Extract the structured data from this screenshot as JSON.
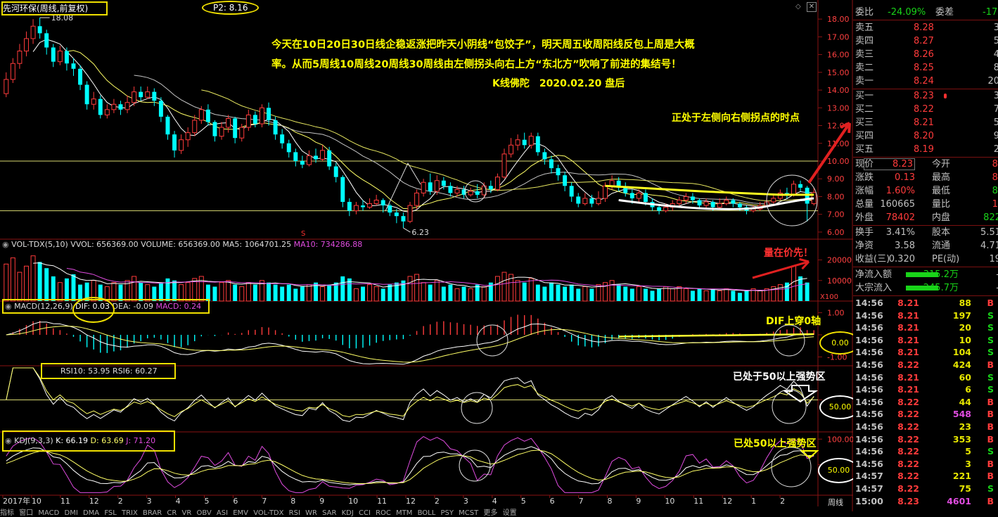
{
  "colors": {
    "up": "#ff3b3b",
    "down": "#00ffff",
    "ma5": "#ffffff",
    "ma10": "#ffff66",
    "ma20": "#c4c4c4",
    "ma30": "#ffff00",
    "annot": "#ffff00",
    "arrow": "#e02020",
    "magenta": "#e04ce0",
    "green": "#19d419"
  },
  "header": {
    "title": "先河环保(周线,前复权)",
    "p2": "P2: 8.16"
  },
  "annotations": {
    "line1": "今天在10日20日30日线企稳返涨把昨天小阴线“包饺子”，明天周五收周阳线反包上周是大概",
    "line2": "率。从而5周线10周线20周线30周线由左侧拐头向右上方“东北方”吹响了前进的集结号！",
    "signature": "K线佛陀　2020.02.20 盘后",
    "turning": "正处于左侧向右侧拐点的时点",
    "vol_first": "量在价先！",
    "dif_cross": "DIF上穿0轴",
    "rsi_strong": "已处于50以上强势区",
    "kdj_strong": "已处50以上强势区"
  },
  "price_pane": {
    "high_label": "18.08",
    "low_label": "6.23",
    "s_marker": "S",
    "axis_ticks": [
      "18.00",
      "17.00",
      "16.00",
      "15.00",
      "14.00",
      "13.00",
      "12.00",
      "11.00",
      "10.00",
      "9.00",
      "8.00",
      "7.00",
      "6.00"
    ],
    "axis_values": [
      18,
      17,
      16,
      15,
      14,
      13,
      12,
      11,
      10,
      9,
      8,
      7,
      6
    ],
    "ymin": 5.6,
    "ymax": 18.6
  },
  "vol_pane": {
    "legend_name": "VOL-TDX(5,10)",
    "legend_vvol": "VVOL: 656369.00",
    "legend_volume": "VOLUME: 656369.00",
    "legend_ma5": "MA5: 1064701.25",
    "legend_ma10": "MA10: 734286.88",
    "axis_ticks": [
      "20000",
      "10000"
    ],
    "axis_values": [
      20000,
      10000
    ],
    "unit": "X100",
    "vmax": 26000
  },
  "macd_pane": {
    "legend_name": "MACD(12,26,9)",
    "legend_dif": "DIF: 0.03",
    "legend_dea": "DEA: -0.09",
    "legend_macd": "MACD: 0.24",
    "axis_ticks": [
      "1.00",
      "0.00",
      "-1.00"
    ],
    "axis_values": [
      1,
      0,
      -1
    ],
    "circled": "0.00",
    "ymin": -1.4,
    "ymax": 1.4
  },
  "rsi_pane": {
    "legend": "RSI10: 53.95 RSI6: 60.27",
    "axis_ticks": [
      "50.00"
    ],
    "axis_values": [
      50
    ],
    "circled": "50.00"
  },
  "kdj_pane": {
    "legend_name": "KDJ(9,3,3)",
    "legend_k": "K: 66.19",
    "legend_d": "D: 63.69",
    "legend_j": "J: 71.20",
    "axis_ticks": [
      "100.00",
      "50.00"
    ],
    "axis_values": [
      100,
      50
    ],
    "circled": "50.00"
  },
  "x_axis": {
    "labels": [
      "2017年",
      "10",
      "11",
      "12",
      "2",
      "3",
      "4",
      "5",
      "6",
      "7",
      "8",
      "9",
      "10",
      "11",
      "12",
      "2",
      "3",
      "4",
      "5",
      "6",
      "7",
      "8",
      "9",
      "10",
      "11",
      "12",
      "1",
      "2"
    ],
    "right_label": "周线",
    "bottom_menu": "指标 窗口 MACD DMI DMA FSL TRIX BRAR CR VR OBV ASI EMV VOL-TDX RSI WR SAR KDJ CCI ROC MTM BOLL PSY MCST 更多 设置"
  },
  "chart_data": {
    "type": "candlestick",
    "candles": [
      [
        13.8,
        14.6,
        15.0,
        13.6
      ],
      [
        14.6,
        15.5,
        15.8,
        14.4
      ],
      [
        15.5,
        16.2,
        16.6,
        15.2
      ],
      [
        16.2,
        16.9,
        17.3,
        15.9
      ],
      [
        16.9,
        17.6,
        18.0,
        16.6
      ],
      [
        17.6,
        17.2,
        18.08,
        16.9
      ],
      [
        17.2,
        16.4,
        17.4,
        16.0
      ],
      [
        16.4,
        15.6,
        16.6,
        15.3
      ],
      [
        15.6,
        16.2,
        16.5,
        15.4
      ],
      [
        16.2,
        15.5,
        16.4,
        15.1
      ],
      [
        15.5,
        15.2,
        15.8,
        14.8
      ],
      [
        15.2,
        14.3,
        15.4,
        14.0
      ],
      [
        14.3,
        13.2,
        14.5,
        12.9
      ],
      [
        13.2,
        13.5,
        13.9,
        12.9
      ],
      [
        13.5,
        12.6,
        13.7,
        12.4
      ],
      [
        12.6,
        12.9,
        13.2,
        12.4
      ],
      [
        12.9,
        13.2,
        13.5,
        12.7
      ],
      [
        13.2,
        12.9,
        13.4,
        12.6
      ],
      [
        12.9,
        13.3,
        13.7,
        12.7
      ],
      [
        13.3,
        13.9,
        14.2,
        13.1
      ],
      [
        13.9,
        13.6,
        14.2,
        13.4
      ],
      [
        13.6,
        13.9,
        14.2,
        13.5
      ],
      [
        13.9,
        13.4,
        14.1,
        13.1
      ],
      [
        13.4,
        12.5,
        13.6,
        12.2
      ],
      [
        12.5,
        11.5,
        12.6,
        11.2
      ],
      [
        11.5,
        10.6,
        11.7,
        10.2
      ],
      [
        10.6,
        11.2,
        11.5,
        10.4
      ],
      [
        11.2,
        11.6,
        11.9,
        10.8
      ],
      [
        11.6,
        12.3,
        12.6,
        11.4
      ],
      [
        12.3,
        12.9,
        13.1,
        12.1
      ],
      [
        12.9,
        12.2,
        13.2,
        12.0
      ],
      [
        12.2,
        11.4,
        12.3,
        11.1
      ],
      [
        11.4,
        11.9,
        12.2,
        11.2
      ],
      [
        11.9,
        12.4,
        12.6,
        11.6
      ],
      [
        12.4,
        11.3,
        12.5,
        11.0
      ],
      [
        11.3,
        11.9,
        12.1,
        11.1
      ],
      [
        11.9,
        12.6,
        12.9,
        11.7
      ],
      [
        12.6,
        12.1,
        12.8,
        11.9
      ],
      [
        12.1,
        13.0,
        13.2,
        11.9
      ],
      [
        13.0,
        12.3,
        13.3,
        12.0
      ],
      [
        12.3,
        11.5,
        12.5,
        11.2
      ],
      [
        11.5,
        11.0,
        11.8,
        10.7
      ],
      [
        11.0,
        10.5,
        11.2,
        10.2
      ],
      [
        10.5,
        10.0,
        10.7,
        9.7
      ],
      [
        10.0,
        9.8,
        10.3,
        9.6
      ],
      [
        9.8,
        10.3,
        10.6,
        9.7
      ],
      [
        10.3,
        10.1,
        10.7,
        9.9
      ],
      [
        10.1,
        10.6,
        10.9,
        10.0
      ],
      [
        10.6,
        9.7,
        10.8,
        9.5
      ],
      [
        9.7,
        9.1,
        9.9,
        8.8
      ],
      [
        9.1,
        7.7,
        9.2,
        7.4
      ],
      [
        7.7,
        7.2,
        7.9,
        6.9
      ],
      [
        7.2,
        7.5,
        7.7,
        7.0
      ],
      [
        7.5,
        7.4,
        7.8,
        7.2
      ],
      [
        7.4,
        7.6,
        7.9,
        7.3
      ],
      [
        7.6,
        7.8,
        8.1,
        7.5
      ],
      [
        7.8,
        7.5,
        7.9,
        7.1
      ],
      [
        7.5,
        7.1,
        7.6,
        6.9
      ],
      [
        7.1,
        6.9,
        7.3,
        6.5
      ],
      [
        6.9,
        6.6,
        7.1,
        6.23
      ],
      [
        6.6,
        7.5,
        7.7,
        6.5
      ],
      [
        7.5,
        8.2,
        8.4,
        7.3
      ],
      [
        8.2,
        8.8,
        9.0,
        8.0
      ],
      [
        8.8,
        8.3,
        9.3,
        8.1
      ],
      [
        8.3,
        8.9,
        9.2,
        8.1
      ],
      [
        8.9,
        8.6,
        9.1,
        8.4
      ],
      [
        8.6,
        8.2,
        8.8,
        8.0
      ],
      [
        8.2,
        8.4,
        8.6,
        8.0
      ],
      [
        8.4,
        8.1,
        8.6,
        7.9
      ],
      [
        8.1,
        8.3,
        8.5,
        8.0
      ],
      [
        8.3,
        8.1,
        8.7,
        7.9
      ],
      [
        8.1,
        8.6,
        8.8,
        7.9
      ],
      [
        8.6,
        8.4,
        8.9,
        8.2
      ],
      [
        8.4,
        9.1,
        9.3,
        8.3
      ],
      [
        9.1,
        10.4,
        10.7,
        9.0
      ],
      [
        10.4,
        10.9,
        11.3,
        10.2
      ],
      [
        10.9,
        11.2,
        11.5,
        10.6
      ],
      [
        11.2,
        10.9,
        11.6,
        10.7
      ],
      [
        10.9,
        11.4,
        11.6,
        10.7
      ],
      [
        11.4,
        10.5,
        11.6,
        10.3
      ],
      [
        10.5,
        10.1,
        10.7,
        9.8
      ],
      [
        10.1,
        9.6,
        10.3,
        9.3
      ],
      [
        9.6,
        9.2,
        9.8,
        8.9
      ],
      [
        9.2,
        8.6,
        9.4,
        8.3
      ],
      [
        8.6,
        8.0,
        8.8,
        7.7
      ],
      [
        8.0,
        7.6,
        8.2,
        7.4
      ],
      [
        7.6,
        7.9,
        8.2,
        7.5
      ],
      [
        7.9,
        7.6,
        8.1,
        7.4
      ],
      [
        7.6,
        7.9,
        8.3,
        7.5
      ],
      [
        7.9,
        8.6,
        8.8,
        7.7
      ],
      [
        8.6,
        8.9,
        9.2,
        8.4
      ],
      [
        8.9,
        8.5,
        9.1,
        8.3
      ],
      [
        8.5,
        8.2,
        8.8,
        8.0
      ],
      [
        8.2,
        7.9,
        8.4,
        7.6
      ],
      [
        7.9,
        8.2,
        8.4,
        7.7
      ],
      [
        8.2,
        7.7,
        8.4,
        7.5
      ],
      [
        7.7,
        7.4,
        7.9,
        7.2
      ],
      [
        7.4,
        7.2,
        7.6,
        7.0
      ],
      [
        7.2,
        7.4,
        7.6,
        7.1
      ],
      [
        7.4,
        7.6,
        7.8,
        7.2
      ],
      [
        7.6,
        7.8,
        8.0,
        7.4
      ],
      [
        7.8,
        8.0,
        8.2,
        7.6
      ],
      [
        8.0,
        7.8,
        8.2,
        7.6
      ],
      [
        7.8,
        7.5,
        7.9,
        7.3
      ],
      [
        7.5,
        7.7,
        7.9,
        7.3
      ],
      [
        7.7,
        7.4,
        7.8,
        7.2
      ],
      [
        7.4,
        7.6,
        7.9,
        7.3
      ],
      [
        7.6,
        7.8,
        8.0,
        7.5
      ],
      [
        7.8,
        7.6,
        7.9,
        7.4
      ],
      [
        7.6,
        7.4,
        7.7,
        7.2
      ],
      [
        7.4,
        7.2,
        7.5,
        7.0
      ],
      [
        7.2,
        7.3,
        7.5,
        7.1
      ],
      [
        7.3,
        7.5,
        7.7,
        7.2
      ],
      [
        7.5,
        7.7,
        7.9,
        7.4
      ],
      [
        7.7,
        7.9,
        8.1,
        7.6
      ],
      [
        7.9,
        8.2,
        8.4,
        7.8
      ],
      [
        8.2,
        8.1,
        8.5,
        7.9
      ],
      [
        8.1,
        8.7,
        8.9,
        8.0
      ],
      [
        8.7,
        8.5,
        8.9,
        8.3
      ],
      [
        8.5,
        7.6,
        8.6,
        6.6
      ],
      [
        7.6,
        8.23,
        8.5,
        7.5
      ]
    ],
    "volumes": [
      18,
      21,
      14,
      17,
      22,
      19,
      16,
      12,
      9,
      11,
      13,
      8,
      9,
      10,
      8,
      7,
      9,
      8,
      10,
      12,
      9,
      8,
      7,
      9,
      11,
      10,
      8,
      9,
      11,
      12,
      8,
      7,
      9,
      10,
      8,
      7,
      9,
      8,
      10,
      9,
      8,
      7,
      8,
      6,
      7,
      8,
      9,
      7,
      8,
      9,
      12,
      11,
      6,
      7,
      8,
      7,
      6,
      8,
      9,
      10,
      12,
      13,
      9,
      8,
      10,
      7,
      8,
      6,
      7,
      6,
      8,
      7,
      9,
      12,
      14,
      13,
      10,
      9,
      11,
      8,
      7,
      9,
      8,
      7,
      8,
      6,
      7,
      6,
      8,
      9,
      10,
      8,
      7,
      6,
      7,
      6,
      5,
      6,
      7,
      6,
      7,
      6,
      5,
      6,
      5,
      6,
      5,
      6,
      5,
      4,
      5,
      6,
      5,
      6,
      7,
      8,
      9,
      17,
      12,
      9
    ]
  },
  "right_panel": {
    "weibi": {
      "label": "委比",
      "value": "-24.09%",
      "label2": "委差",
      "value2": "-17"
    },
    "asks": [
      {
        "label": "卖五",
        "price": "8.28",
        "vol": "3"
      },
      {
        "label": "卖四",
        "price": "8.27",
        "vol": "5"
      },
      {
        "label": "卖三",
        "price": "8.26",
        "vol": "4"
      },
      {
        "label": "卖二",
        "price": "8.25",
        "vol": "8"
      },
      {
        "label": "卖一",
        "price": "8.24",
        "vol": "20"
      }
    ],
    "bids": [
      {
        "label": "买一",
        "price": "8.23",
        "vol": "3"
      },
      {
        "label": "买二",
        "price": "8.22",
        "vol": "7"
      },
      {
        "label": "买三",
        "price": "8.21",
        "vol": "5"
      },
      {
        "label": "买四",
        "price": "8.20",
        "vol": "9"
      },
      {
        "label": "买五",
        "price": "8.19",
        "vol": "2"
      }
    ],
    "stats": [
      {
        "l1": "现价",
        "v1": "8.23",
        "c1": "red",
        "l2": "今开",
        "v2": "8.",
        "c2": "red"
      },
      {
        "l1": "涨跌",
        "v1": "0.13",
        "c1": "red",
        "l2": "最高",
        "v2": "8.",
        "c2": "red"
      },
      {
        "l1": "涨幅",
        "v1": "1.60%",
        "c1": "red",
        "l2": "最低",
        "v2": "8.",
        "c2": "green"
      },
      {
        "l1": "总量",
        "v1": "160665",
        "c1": "lbl",
        "l2": "量比",
        "v2": "1.",
        "c2": "red"
      },
      {
        "l1": "外盘",
        "v1": "78402",
        "c1": "red",
        "l2": "内盘",
        "v2": "822",
        "c2": "green"
      }
    ],
    "stats2": [
      {
        "l1": "换手",
        "v1": "3.41%",
        "l2": "股本",
        "v2": "5.51"
      },
      {
        "l1": "净资",
        "v1": "3.58",
        "l2": "流通",
        "v2": "4.71"
      },
      {
        "l1": "收益(三)",
        "v1": "0.320",
        "l2": "PE(动)",
        "v2": "19"
      }
    ],
    "flows": [
      {
        "label": "净流入额",
        "value": "-315.2万",
        "tail": "-"
      },
      {
        "label": "大宗流入",
        "value": "-245.7万",
        "tail": "-"
      }
    ],
    "ticks": [
      [
        "14:56",
        "8.21",
        "88",
        "B"
      ],
      [
        "14:56",
        "8.21",
        "197",
        "S"
      ],
      [
        "14:56",
        "8.21",
        "20",
        "S"
      ],
      [
        "14:56",
        "8.21",
        "10",
        "S"
      ],
      [
        "14:56",
        "8.21",
        "104",
        "S"
      ],
      [
        "14:56",
        "8.22",
        "424",
        "B"
      ],
      [
        "14:56",
        "8.21",
        "60",
        "S"
      ],
      [
        "14:56",
        "8.21",
        "6",
        "S"
      ],
      [
        "14:56",
        "8.22",
        "44",
        "B"
      ],
      [
        "14:56",
        "8.22",
        "548",
        "B"
      ],
      [
        "14:56",
        "8.22",
        "23",
        "B"
      ],
      [
        "14:56",
        "8.22",
        "353",
        "B"
      ],
      [
        "14:56",
        "8.22",
        "5",
        "S"
      ],
      [
        "14:56",
        "8.22",
        "3",
        "B"
      ],
      [
        "14:57",
        "8.22",
        "221",
        "B"
      ],
      [
        "14:57",
        "8.22",
        "75",
        "S"
      ],
      [
        "15:00",
        "8.23",
        "4601",
        "B"
      ]
    ]
  }
}
